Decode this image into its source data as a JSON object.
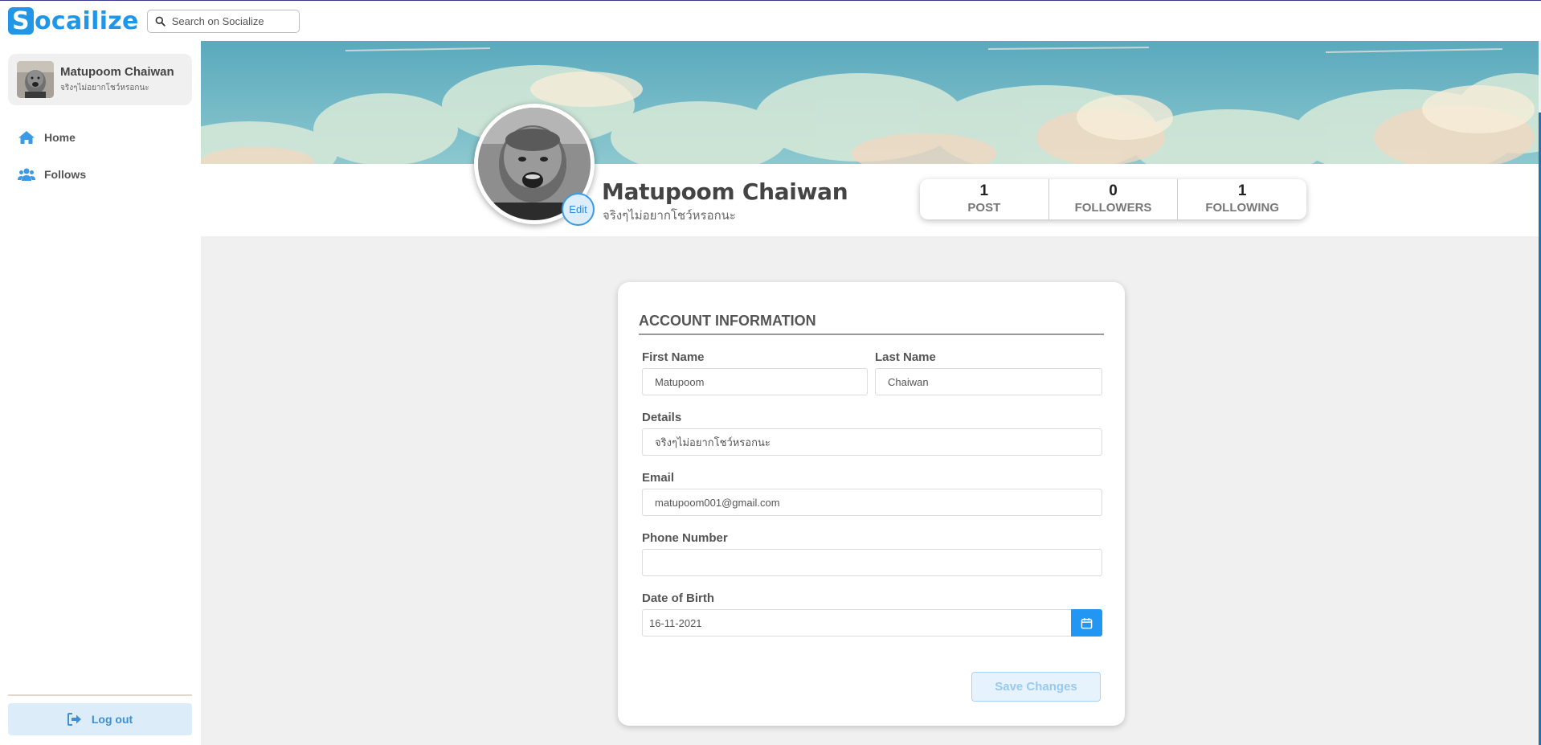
{
  "brand": {
    "logo_initial": "S",
    "logo_rest": "ocailize"
  },
  "search": {
    "placeholder": "Search on Socialize"
  },
  "user": {
    "name": "Matupoom Chaiwan",
    "bio": "จริงๆไม่อยากโชว์หรอกนะ"
  },
  "sidebar": {
    "items": [
      {
        "label": "Home",
        "icon": "home-icon"
      },
      {
        "label": "Follows",
        "icon": "users-icon"
      }
    ],
    "logout_label": "Log out"
  },
  "profile": {
    "edit_label": "Edit",
    "stats": [
      {
        "value": "1",
        "label": "POST"
      },
      {
        "value": "0",
        "label": "FOLLOWERS"
      },
      {
        "value": "1",
        "label": "FOLLOWING"
      }
    ]
  },
  "account": {
    "title": "ACCOUNT INFORMATION",
    "first_name_label": "First Name",
    "first_name_value": "Matupoom",
    "last_name_label": "Last Name",
    "last_name_value": "Chaiwan",
    "details_label": "Details",
    "details_value": "จริงๆไม่อยากโชว์หรอกนะ",
    "email_label": "Email",
    "email_value": "matupoom001@gmail.com",
    "phone_label": "Phone Number",
    "phone_value": "",
    "dob_label": "Date of Birth",
    "dob_value": "16-11-2021",
    "save_label": "Save Changes"
  },
  "colors": {
    "accent": "#1f96e8",
    "sidebar_icon": "#3a9ae6",
    "logout_bg": "#dcecf8"
  }
}
